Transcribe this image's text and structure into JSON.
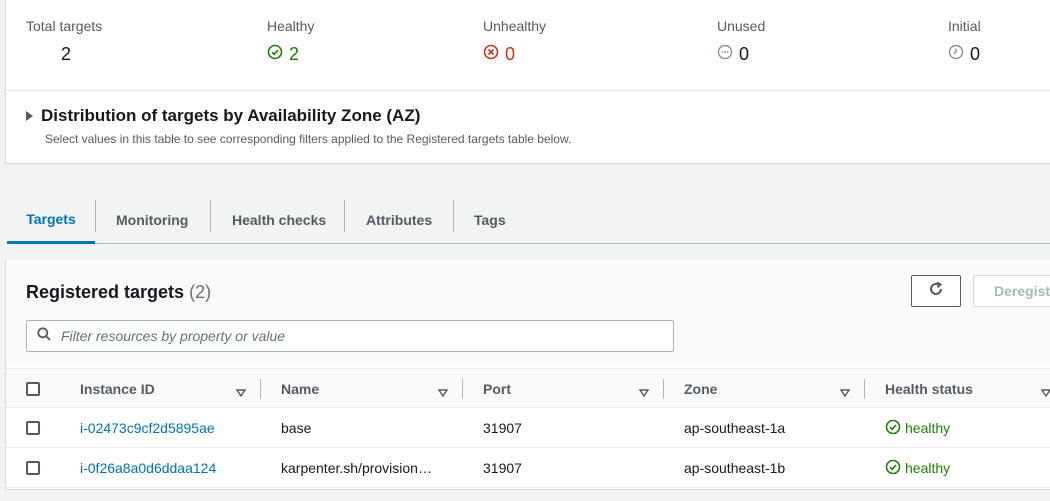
{
  "summary": {
    "total": {
      "label": "Total targets",
      "value": "2"
    },
    "healthy": {
      "label": "Healthy",
      "value": "2"
    },
    "unhealthy": {
      "label": "Unhealthy",
      "value": "0"
    },
    "unused": {
      "label": "Unused",
      "value": "0"
    },
    "initial": {
      "label": "Initial",
      "value": "0"
    }
  },
  "distribution": {
    "title": "Distribution of targets by Availability Zone (AZ)",
    "description": "Select values in this table to see corresponding filters applied to the Registered targets table below."
  },
  "tabs": [
    "Targets",
    "Monitoring",
    "Health checks",
    "Attributes",
    "Tags"
  ],
  "registered": {
    "title": "Registered targets",
    "count": "(2)",
    "deregister_label": "Deregist",
    "search_placeholder": "Filter resources by property or value"
  },
  "table": {
    "columns": [
      "Instance ID",
      "Name",
      "Port",
      "Zone",
      "Health status"
    ],
    "rows": [
      {
        "instance_id": "i-02473c9cf2d5895ae",
        "name": "base",
        "port": "31907",
        "zone": "ap-southeast-1a",
        "health": "healthy"
      },
      {
        "instance_id": "i-0f26a8a0d6ddaa124",
        "name": "karpenter.sh/provision…",
        "port": "31907",
        "zone": "ap-southeast-1b",
        "health": "healthy"
      }
    ]
  },
  "colors": {
    "accent": "#0073bb",
    "healthy": "#1d8102",
    "unhealthy": "#d13212",
    "muted": "#687078"
  }
}
